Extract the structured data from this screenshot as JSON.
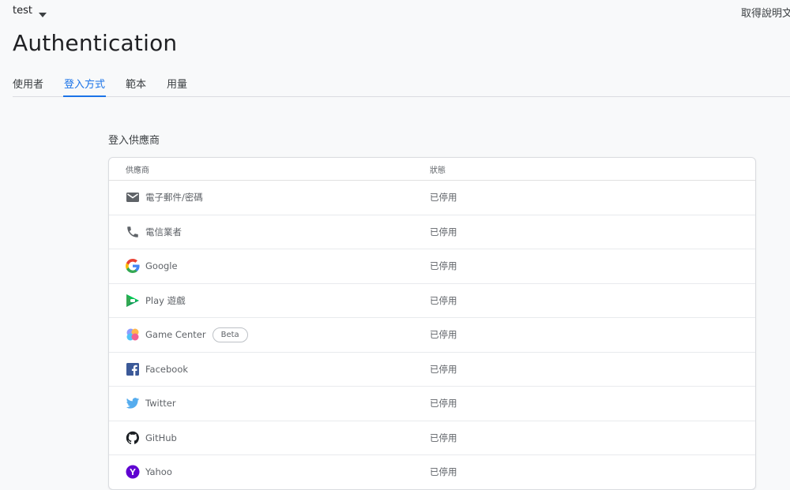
{
  "header": {
    "project_name": "test",
    "help_text": "取得說明文件",
    "page_title": "Authentication"
  },
  "tabs": [
    {
      "label": "使用者",
      "active": false
    },
    {
      "label": "登入方式",
      "active": true
    },
    {
      "label": "範本",
      "active": false
    },
    {
      "label": "用量",
      "active": false
    }
  ],
  "section_title": "登入供應商",
  "table": {
    "columns": {
      "provider": "供應商",
      "status": "狀態"
    },
    "rows": [
      {
        "provider": "電子郵件/密碼",
        "icon": "email-icon",
        "status": "已停用"
      },
      {
        "provider": "電信業者",
        "icon": "phone-icon",
        "status": "已停用"
      },
      {
        "provider": "Google",
        "icon": "google-icon",
        "status": "已停用"
      },
      {
        "provider": "Play 遊戲",
        "icon": "play-games-icon",
        "status": "已停用"
      },
      {
        "provider": "Game Center",
        "icon": "game-center-icon",
        "badge": "Beta",
        "status": "已停用"
      },
      {
        "provider": "Facebook",
        "icon": "facebook-icon",
        "status": "已停用"
      },
      {
        "provider": "Twitter",
        "icon": "twitter-icon",
        "status": "已停用"
      },
      {
        "provider": "GitHub",
        "icon": "github-icon",
        "status": "已停用"
      },
      {
        "provider": "Yahoo",
        "icon": "yahoo-icon",
        "status": "已停用"
      }
    ]
  },
  "colors": {
    "accent": "#1a73e8",
    "google_blue": "#4285f4",
    "google_red": "#ea4335",
    "google_yellow": "#fbbc05",
    "google_green": "#34a853",
    "facebook": "#3b5998",
    "twitter": "#55acee",
    "yahoo": "#5f01d1"
  }
}
